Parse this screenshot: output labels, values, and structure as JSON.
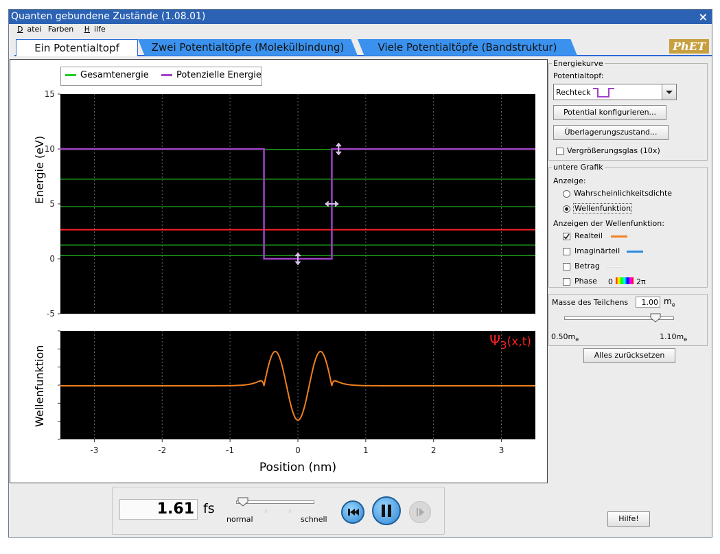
{
  "window": {
    "title": "Quanten gebundene Zustände (1.08.01)",
    "close": "×"
  },
  "menu": [
    {
      "pre": "",
      "u": "D",
      "post": "atei"
    },
    {
      "pre": "Farben",
      "u": "",
      "post": ""
    },
    {
      "pre": "",
      "u": "H",
      "post": "ilfe"
    }
  ],
  "tabs": [
    "Ein Potentialtopf",
    "Zwei Potentialtöpfe (Molekülbindung)",
    "Viele Potentialtöpfe (Bandstruktur)"
  ],
  "logo": "PhET",
  "colors": {
    "total_energy": "#22cc22",
    "potential_energy": "#a040c8",
    "selected_level": "#ff2020",
    "wavefunction": "#f08020",
    "imaginary": "#2a8ae0",
    "magnitude": "#ffffff",
    "plot_bg": "#000000"
  },
  "chart_data": [
    {
      "type": "line",
      "legend": [
        "Gesamtenergie",
        "Potenzielle Energie"
      ],
      "ylabel": "Energie (eV)",
      "ylim": [
        -5,
        15
      ],
      "xlim": [
        -3.5,
        3.5
      ],
      "yticks": [
        "15",
        "10",
        "5",
        "0",
        "-5"
      ],
      "ytick_values": [
        15,
        10,
        5,
        0,
        -5
      ],
      "energy_levels": [
        0.3,
        1.25,
        2.65,
        4.75,
        7.25,
        9.95
      ],
      "selected_level": 2.65,
      "series": [
        {
          "name": "Potenzielle Energie",
          "x": [
            -3.5,
            -0.5,
            -0.5,
            0.5,
            0.5,
            3.5
          ],
          "y": [
            10,
            10,
            0,
            0,
            10,
            10
          ]
        }
      ]
    },
    {
      "type": "line",
      "ylabel": "Wellenfunktion",
      "xlabel": "Position (nm)",
      "xlim": [
        -3.5,
        3.5
      ],
      "xticks": [
        "-3",
        "-2",
        "-1",
        "0",
        "1",
        "2",
        "3"
      ],
      "xtick_values": [
        -3,
        -2,
        -1,
        0,
        1,
        2,
        3
      ],
      "annotation": "Ψ3(x,t)",
      "series": [
        {
          "name": "Realteil"
        }
      ]
    }
  ],
  "annotation": {
    "psi": "Ψ",
    "sub": "3",
    "args": "(x,t)"
  },
  "energiekurve": {
    "title": "Energiekurve",
    "potentialtopf_label": "Potentialtopf:",
    "selected": "Rechteck",
    "configure_button": "Potential konfigurieren...",
    "superposition_button": "Überlagerungszustand...",
    "magnifier_label": "Vergrößerungsglas (10x)",
    "magnifier_checked": false
  },
  "untere_grafik": {
    "title": "untere Grafik",
    "anzeige_label": "Anzeige:",
    "options": [
      "Wahrscheinlichkeitsdichte",
      "Wellenfunktion"
    ],
    "selected": "Wellenfunktion",
    "wave_display_label": "Anzeigen der Wellenfunktion:",
    "checks": [
      {
        "label": "Realteil",
        "checked": true
      },
      {
        "label": "Imaginärteil",
        "checked": false
      },
      {
        "label": "Betrag",
        "checked": false
      },
      {
        "label": "Phase",
        "checked": false
      }
    ],
    "phase_start": "0",
    "phase_end": "2π"
  },
  "mass": {
    "label": "Masse des Teilchens",
    "value": "1.00",
    "unit": "m",
    "unit_sub": "e",
    "min": "0.50m",
    "max": "1.10m",
    "min_value": 0.5,
    "max_value": 1.1,
    "current": 1.0
  },
  "reset_button": "Alles zurücksetzen",
  "time": {
    "value": "1.61",
    "unit": "fs",
    "speed_min": "normal",
    "speed_max": "schnell",
    "speed_fraction": 0.05
  },
  "help_button": "Hilfe!"
}
